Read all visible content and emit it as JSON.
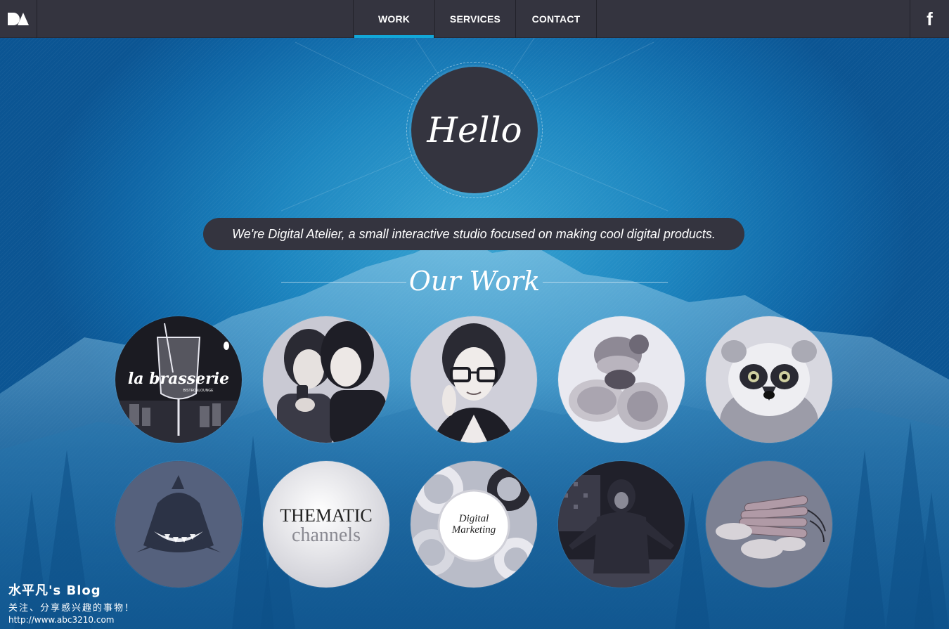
{
  "nav": {
    "logo_label": "DA",
    "items": [
      {
        "label": "WORK",
        "active": true
      },
      {
        "label": "SERVICES",
        "active": false
      },
      {
        "label": "CONTACT",
        "active": false
      }
    ],
    "social_label": "f",
    "accent_color": "#12a7d8"
  },
  "hero": {
    "hello": "Hello",
    "tagline": "We're Digital Atelier, a small interactive studio focused on making cool digital products."
  },
  "work": {
    "title": "Our Work",
    "items": [
      {
        "name": "la brasserie",
        "overlay_text": "la brasserie",
        "subtext": "BISTRO&LOUNGE"
      },
      {
        "name": "two women with phone",
        "overlay_text": ""
      },
      {
        "name": "woman with glasses",
        "overlay_text": ""
      },
      {
        "name": "pastries",
        "overlay_text": ""
      },
      {
        "name": "lemur",
        "overlay_text": ""
      },
      {
        "name": "shark",
        "overlay_text": ""
      },
      {
        "name": "thematic channels",
        "overlay_text_1": "THEMATIC",
        "overlay_text_2": "channels"
      },
      {
        "name": "digital marketing",
        "overlay_text_1": "Digital",
        "overlay_text_2": "Marketing"
      },
      {
        "name": "hooded man",
        "overlay_text": ""
      },
      {
        "name": "dynamite",
        "overlay_text": ""
      }
    ]
  },
  "watermark": {
    "title": "水平凡's Blog",
    "subtitle": "关注、分享感兴趣的事物！",
    "url": "http://www.abc3210.com"
  },
  "colors": {
    "navbar_bg": "#34343f",
    "background": "#1d86c0",
    "dark_panel": "#34343f"
  }
}
